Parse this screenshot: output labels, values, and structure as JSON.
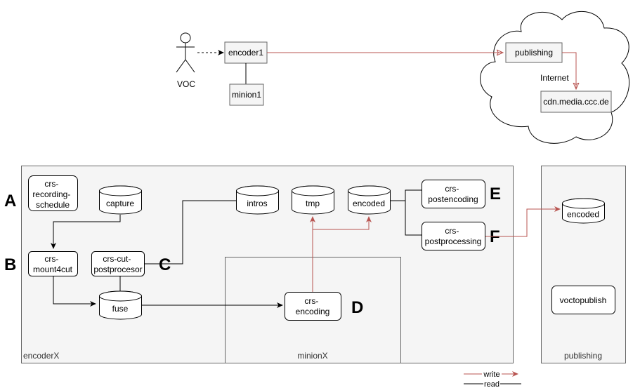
{
  "diagram": {
    "actor": {
      "label": "VOC"
    },
    "top_nodes": {
      "encoder1": "encoder1",
      "minion1": "minion1",
      "publishing": "publishing",
      "cdn": "cdn.media.ccc.de",
      "cloud_label": "Internet"
    },
    "containers": {
      "encoderX": "encoderX",
      "minionX": "minionX",
      "publishing": "publishing"
    },
    "processes": {
      "recording_schedule": [
        "crs-",
        "recording-",
        "schedule"
      ],
      "mount4cut": [
        "crs-",
        "mount4cut"
      ],
      "cut_postprocesor": [
        "crs-cut-",
        "postprocesor"
      ],
      "encoding": [
        "crs-",
        "encoding"
      ],
      "postencoding": [
        "crs-",
        "postencoding"
      ],
      "postprocessing": [
        "crs-",
        "postprocessing"
      ],
      "voctopublish": [
        "voctopublish"
      ]
    },
    "storages": {
      "capture": "capture",
      "intros": "intros",
      "tmp": "tmp",
      "encoded": "encoded",
      "fuse": "fuse",
      "publishing_encoded": "encoded"
    },
    "step_labels": {
      "A": "A",
      "B": "B",
      "C": "C",
      "D": "D",
      "E": "E",
      "F": "F"
    },
    "legend": {
      "write": "write",
      "read": "read"
    },
    "colors": {
      "write": "#b85450",
      "read": "#000000",
      "container_fill": "#f5f5f5",
      "container_stroke": "#666666"
    }
  }
}
